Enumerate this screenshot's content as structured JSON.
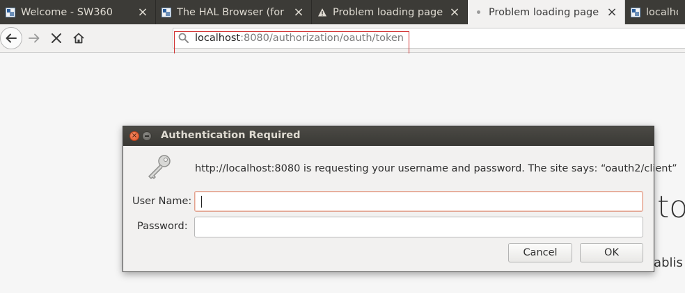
{
  "tabs": [
    {
      "title": "Welcome - SW360",
      "icon": "site-icon",
      "active": false
    },
    {
      "title": "The HAL Browser (for Sp",
      "icon": "site-icon",
      "active": false
    },
    {
      "title": "Problem loading page",
      "icon": "warning-icon",
      "active": false
    },
    {
      "title": "Problem loading page",
      "icon": "loading-dot-icon",
      "active": true
    },
    {
      "title": "localhos",
      "icon": "site-icon",
      "active": false
    }
  ],
  "tab_close_glyph": "×",
  "navbar": {
    "url_host": "localhost",
    "url_rest": ":8080/authorization/oauth/token"
  },
  "background_page": {
    "heading_fragment": "to",
    "text_fragment": "tablis"
  },
  "dialog": {
    "title": "Authentication Required",
    "message": "http://localhost:8080 is requesting your username and password. The site says: “oauth2/client”",
    "username_label": "User Name:",
    "username_value": "",
    "password_label": "Password:",
    "password_value": "",
    "cancel_label": "Cancel",
    "ok_label": "OK"
  },
  "colors": {
    "tabstrip_bg": "#3c3b37",
    "highlight_border": "#d13131",
    "dialog_close": "#e0562a"
  }
}
